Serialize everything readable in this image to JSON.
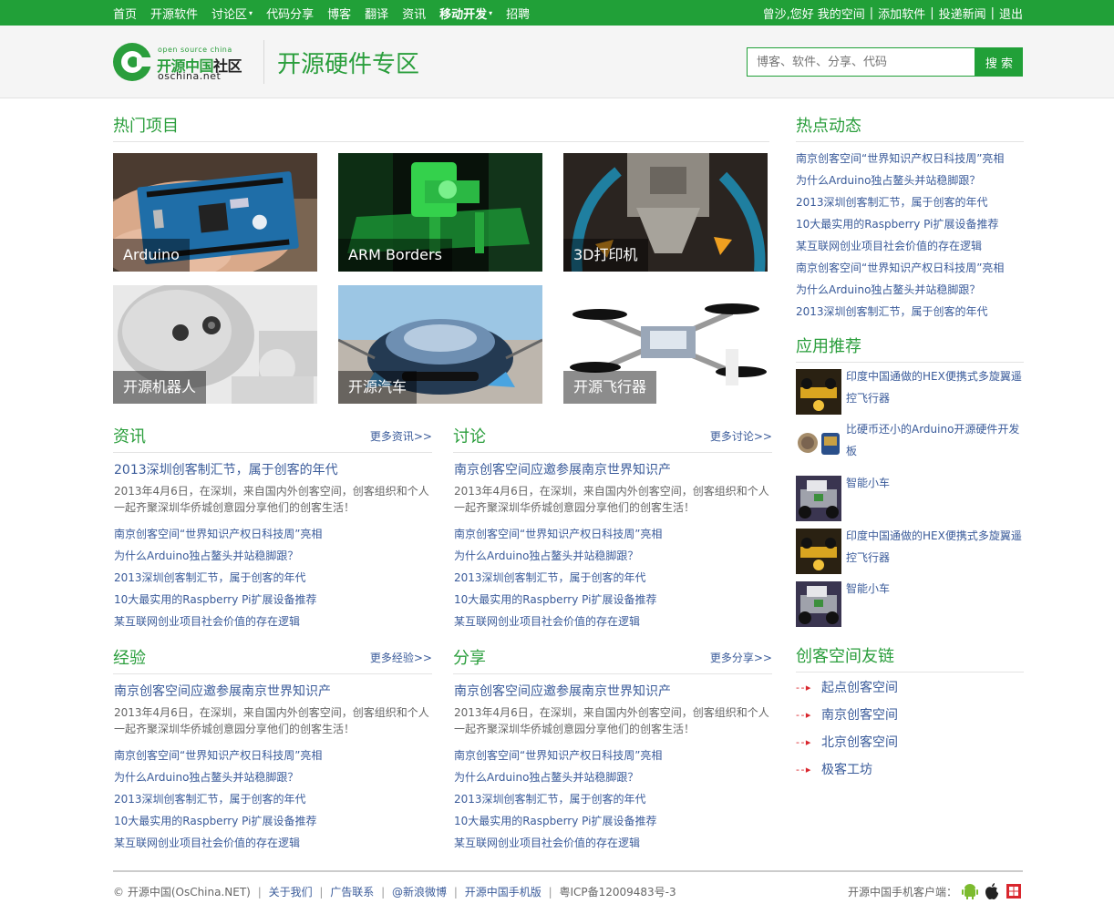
{
  "topnav": {
    "items": [
      {
        "label": "首页",
        "bold": false,
        "caret": ""
      },
      {
        "label": "开源软件",
        "bold": false,
        "caret": ""
      },
      {
        "label": "讨论区",
        "bold": false,
        "caret": "▾"
      },
      {
        "label": "代码分享",
        "bold": false,
        "caret": ""
      },
      {
        "label": "博客",
        "bold": false,
        "caret": ""
      },
      {
        "label": "翻译",
        "bold": false,
        "caret": ""
      },
      {
        "label": "资讯",
        "bold": false,
        "caret": ""
      },
      {
        "label": "移动开发",
        "bold": true,
        "caret": "▾"
      },
      {
        "label": "招聘",
        "bold": false,
        "caret": ""
      }
    ],
    "user": {
      "greeting": "曾沙,您好",
      "my_space": "我的空间",
      "add_software": "添加软件",
      "submit_news": "投递新闻",
      "logout": "退出",
      "sep": "|"
    }
  },
  "header": {
    "logo_small": "open source china",
    "logo_cn_a": "开源中国",
    "logo_cn_b": "社区",
    "logo_net": "oschina.net",
    "title": "开源硬件专区",
    "search_placeholder": "博客、软件、分享、代码",
    "search_button": "搜 索"
  },
  "hot_projects": {
    "title": "热门项目",
    "items": [
      {
        "caption": "Arduino"
      },
      {
        "caption": "ARM Borders"
      },
      {
        "caption": "3D打印机"
      },
      {
        "caption": "开源机器人"
      },
      {
        "caption": "开源汽车"
      },
      {
        "caption": "开源飞行器"
      }
    ]
  },
  "news": {
    "title": "资讯",
    "more": "更多资讯>>",
    "headline": "2013深圳创客制汇节，属于创客的年代",
    "summary": "2013年4月6日，在深圳，来自国内外创客空间，创客组织和个人一起齐聚深圳华侨城创意园分享他们的创客生活！",
    "items": [
      "南京创客空间“世界知识产权日科技周”亮相",
      "为什么Arduino独占鳌头并站稳脚跟？",
      "2013深圳创客制汇节，属于创客的年代",
      "10大最实用的Raspberry Pi扩展设备推荐",
      "某互联网创业项目社会价值的存在逻辑"
    ]
  },
  "discuss": {
    "title": "讨论",
    "more": "更多讨论>>",
    "headline": "南京创客空间应邀参展南京世界知识产",
    "summary": "2013年4月6日，在深圳，来自国内外创客空间，创客组织和个人一起齐聚深圳华侨城创意园分享他们的创客生活！",
    "items": [
      "南京创客空间“世界知识产权日科技周”亮相",
      "为什么Arduino独占鳌头并站稳脚跟？",
      "2013深圳创客制汇节，属于创客的年代",
      "10大最实用的Raspberry Pi扩展设备推荐",
      "某互联网创业项目社会价值的存在逻辑"
    ]
  },
  "experience": {
    "title": "经验",
    "more": "更多经验>>",
    "headline": "南京创客空间应邀参展南京世界知识产",
    "summary": "2013年4月6日，在深圳，来自国内外创客空间，创客组织和个人一起齐聚深圳华侨城创意园分享他们的创客生活！",
    "items": [
      "南京创客空间“世界知识产权日科技周”亮相",
      "为什么Arduino独占鳌头并站稳脚跟？",
      "2013深圳创客制汇节，属于创客的年代",
      "10大最实用的Raspberry Pi扩展设备推荐",
      "某互联网创业项目社会价值的存在逻辑"
    ]
  },
  "share": {
    "title": "分享",
    "more": "更多分享>>",
    "headline": "南京创客空间应邀参展南京世界知识产",
    "summary": "2013年4月6日，在深圳，来自国内外创客空间，创客组织和个人一起齐聚深圳华侨城创意园分享他们的创客生活！",
    "items": [
      "南京创客空间“世界知识产权日科技周”亮相",
      "为什么Arduino独占鳌头并站稳脚跟？",
      "2013深圳创客制汇节，属于创客的年代",
      "10大最实用的Raspberry Pi扩展设备推荐",
      "某互联网创业项目社会价值的存在逻辑"
    ]
  },
  "hot_news": {
    "title": "热点动态",
    "items": [
      "南京创客空间“世界知识产权日科技周”亮相",
      "为什么Arduino独占鳌头并站稳脚跟？",
      "2013深圳创客制汇节，属于创客的年代",
      "10大最实用的Raspberry Pi扩展设备推荐",
      "某互联网创业项目社会价值的存在逻辑",
      "南京创客空间“世界知识产权日科技周”亮相",
      "为什么Arduino独占鳌头并站稳脚跟？",
      "2013深圳创客制汇节，属于创客的年代"
    ]
  },
  "apps": {
    "title": "应用推荐",
    "items": [
      {
        "text": "印度中国通做的HEX便携式多旋翼遥控飞行器"
      },
      {
        "text": "比硬币还小的Arduino开源硬件开发板"
      },
      {
        "text": "智能小车"
      },
      {
        "text": "印度中国通做的HEX便携式多旋翼遥控飞行器"
      },
      {
        "text": "智能小车"
      }
    ]
  },
  "links": {
    "title": "创客空间友链",
    "arrow": "- - ▸",
    "items": [
      "起点创客空间",
      "南京创客空间",
      "北京创客空间",
      "极客工坊"
    ]
  },
  "footer": {
    "copyright": "© 开源中国(OsChina.NET)",
    "links": [
      "关于我们",
      "广告联系",
      "@新浪微博",
      "开源中国手机版"
    ],
    "icp": "粤ICP备12009483号-3",
    "sep": "|",
    "mobile_label": "开源中国手机客户端："
  },
  "colors": {
    "brand_green": "#21a038",
    "link_blue": "#3a5b9a",
    "accent_red": "#d9272e"
  }
}
